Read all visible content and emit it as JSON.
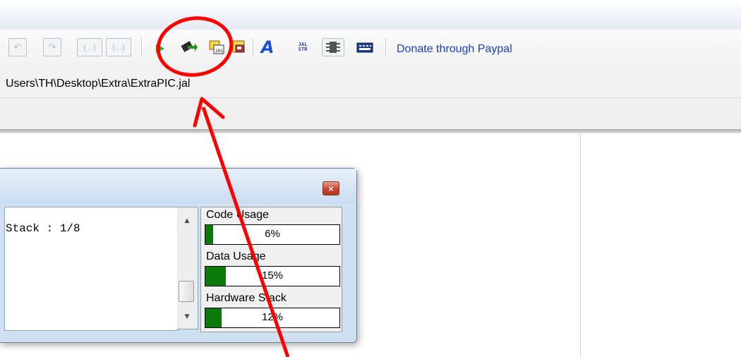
{
  "toolbar": {
    "buttons": [
      {
        "name": "undo",
        "glyph": "↶"
      },
      {
        "name": "redo",
        "glyph": "↷"
      },
      {
        "name": "comment-block",
        "glyph": "{..}"
      },
      {
        "name": "uncomment-block",
        "glyph": "{..}"
      },
      {
        "name": "run",
        "glyph": "▶"
      },
      {
        "name": "compile",
        "glyph": ""
      },
      {
        "name": "program-chip",
        "glyph": ""
      },
      {
        "name": "chip-settings",
        "glyph": ""
      },
      {
        "name": "font",
        "glyph": "A"
      },
      {
        "name": "jal-str",
        "glyph": "JAL STR"
      },
      {
        "name": "ic-pinout",
        "glyph": ""
      },
      {
        "name": "keyboard",
        "glyph": ""
      }
    ],
    "donate_label": "Donate through Paypal"
  },
  "path": {
    "text": "Users\\TH\\Desktop\\Extra\\ExtraPIC.jal"
  },
  "dialog": {
    "close_glyph": "×",
    "output_text": "Stack : 1/8",
    "scroll_up": "▲",
    "scroll_down": "▼",
    "usage": [
      {
        "label": "Code Usage",
        "percent": 6,
        "display": "6%"
      },
      {
        "label": "Data Usage",
        "percent": 15,
        "display": "15%"
      },
      {
        "label": "Hardware Stack",
        "percent": 12,
        "display": "12%"
      }
    ]
  },
  "colors": {
    "bar_fill": "#0b7a0b",
    "annotation": "#ff0000",
    "link": "#1a3fbf"
  }
}
